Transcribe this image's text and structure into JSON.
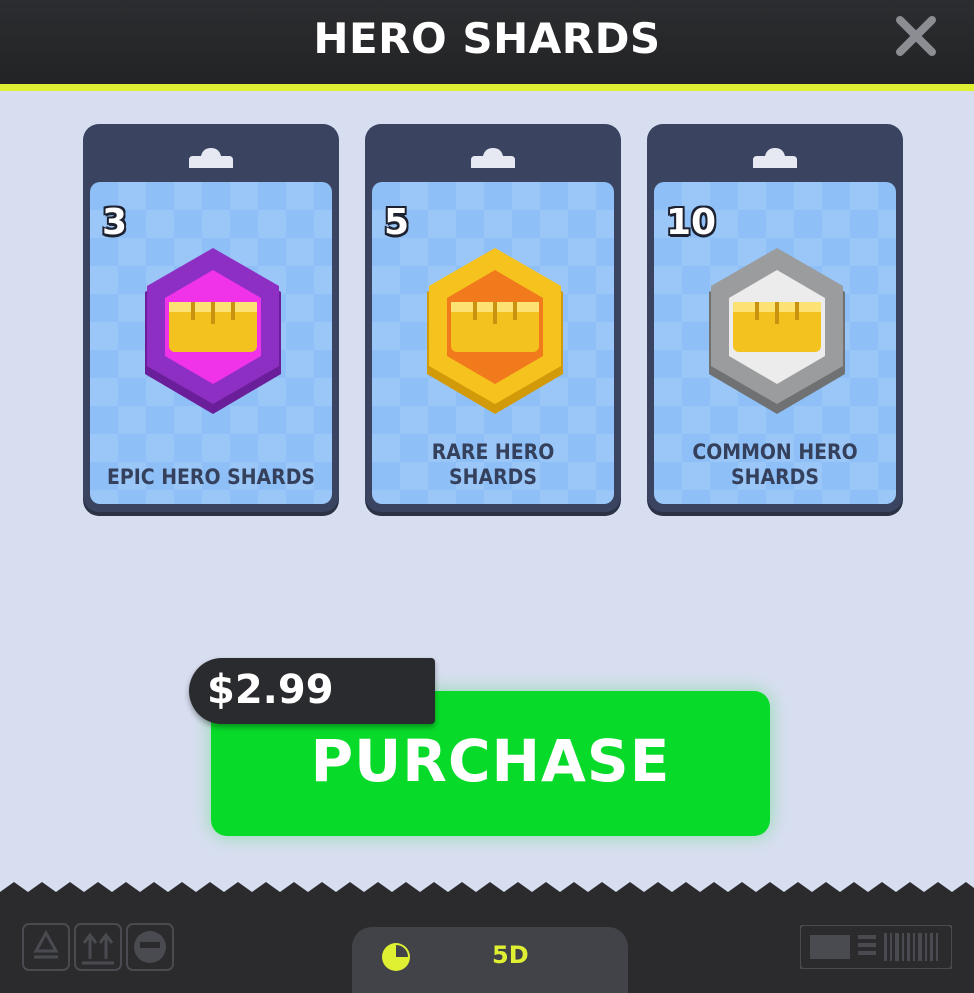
{
  "header": {
    "title": "HERO SHARDS"
  },
  "cards": [
    {
      "count": "3",
      "label": "EPIC HERO SHARDS",
      "rarity": "epic",
      "hex_outer": "#8e2fc4",
      "hex_inner": "#f033e8"
    },
    {
      "count": "5",
      "label": "RARE HERO SHARDS",
      "rarity": "rare",
      "hex_outer": "#f6c21e",
      "hex_inner": "#f07a1c"
    },
    {
      "count": "10",
      "label": "COMMON HERO SHARDS",
      "rarity": "common",
      "hex_outer": "#9a9c9e",
      "hex_inner": "#ececec"
    }
  ],
  "purchase": {
    "price": "$2.99",
    "label": "PURCHASE"
  },
  "footer": {
    "timer": "5D"
  },
  "colors": {
    "accent": "#dff032",
    "purchase_green": "#08da2a",
    "card_frame": "#3a4461",
    "card_bg": "#8ec0f7"
  },
  "icons": {
    "close": "close-icon",
    "timer": "clock-icon",
    "recycle": "recycle-icon",
    "this_way_up": "arrows-up-icon",
    "fragile": "face-icon",
    "barcode": "barcode-icon"
  }
}
